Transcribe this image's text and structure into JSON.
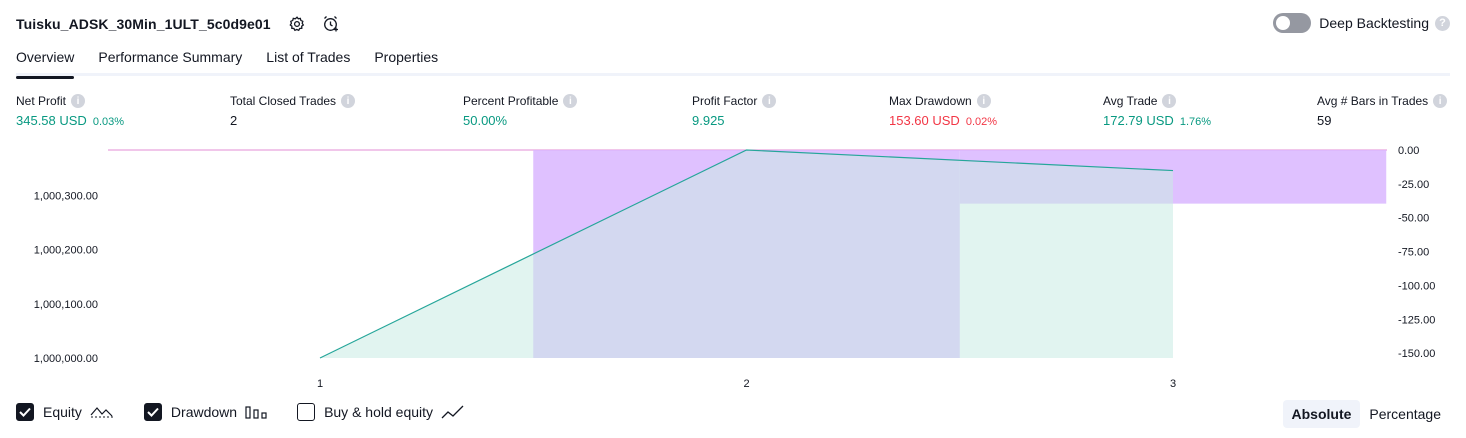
{
  "header": {
    "strategy_name": "Tuisku_ADSK_30Min_1ULT_5c0d9e01",
    "deep_backtesting_label": "Deep Backtesting",
    "deep_backtesting_on": false,
    "help_glyph": "?"
  },
  "tabs": [
    {
      "label": "Overview",
      "active": true
    },
    {
      "label": "Performance Summary",
      "active": false
    },
    {
      "label": "List of Trades",
      "active": false
    },
    {
      "label": "Properties",
      "active": false
    }
  ],
  "metrics": [
    {
      "label": "Net Profit",
      "value": "345.58 USD",
      "pct": "0.03%",
      "color": "green"
    },
    {
      "label": "Total Closed Trades",
      "value": "2",
      "pct": "",
      "color": "dark"
    },
    {
      "label": "Percent Profitable",
      "value": "50.00%",
      "pct": "",
      "color": "green"
    },
    {
      "label": "Profit Factor",
      "value": "9.925",
      "pct": "",
      "color": "green"
    },
    {
      "label": "Max Drawdown",
      "value": "153.60 USD",
      "pct": "0.02%",
      "color": "red"
    },
    {
      "label": "Avg Trade",
      "value": "172.79 USD",
      "pct": "1.76%",
      "color": "green"
    },
    {
      "label": "Avg # Bars in Trades",
      "value": "59",
      "pct": "",
      "color": "dark"
    }
  ],
  "info_glyph": "i",
  "chart_data": {
    "type": "area",
    "x_ticks": [
      "1",
      "2",
      "3"
    ],
    "left_axis": {
      "ticks": [
        "1,000,000.00",
        "1,000,100.00",
        "1,000,200.00",
        "1,000,300.00"
      ],
      "range": [
        1000000,
        1000384
      ]
    },
    "right_axis": {
      "ticks": [
        "0.00",
        "-25.00",
        "-50.00",
        "-75.00",
        "-100.00",
        "-125.00",
        "-150.00"
      ],
      "range": [
        -153.6,
        0
      ]
    },
    "equity": {
      "x": [
        1,
        2,
        3
      ],
      "y": [
        1000000,
        1000384,
        1000346
      ]
    },
    "drawdown": [
      {
        "x_from": 1.5,
        "x_to": 2.5,
        "value": -153.6
      },
      {
        "x_from": 2.5,
        "x_to": 3.5,
        "value": -39.6
      }
    ],
    "colors": {
      "equity_line": "#26a69a",
      "equity_fill": "#c8ebe4",
      "drawdown_fill": "#d9b6ff",
      "overlap_fill": "#aab5e0",
      "zero_line": "#e38cd4"
    }
  },
  "legend": {
    "items": [
      {
        "label": "Equity",
        "checked": true,
        "icon": "equity-line-icon"
      },
      {
        "label": "Drawdown",
        "checked": true,
        "icon": "drawdown-bars-icon"
      },
      {
        "label": "Buy & hold equity",
        "checked": false,
        "icon": "buy-hold-line-icon"
      }
    ]
  },
  "mode": {
    "absolute_label": "Absolute",
    "percentage_label": "Percentage",
    "active": "absolute"
  }
}
